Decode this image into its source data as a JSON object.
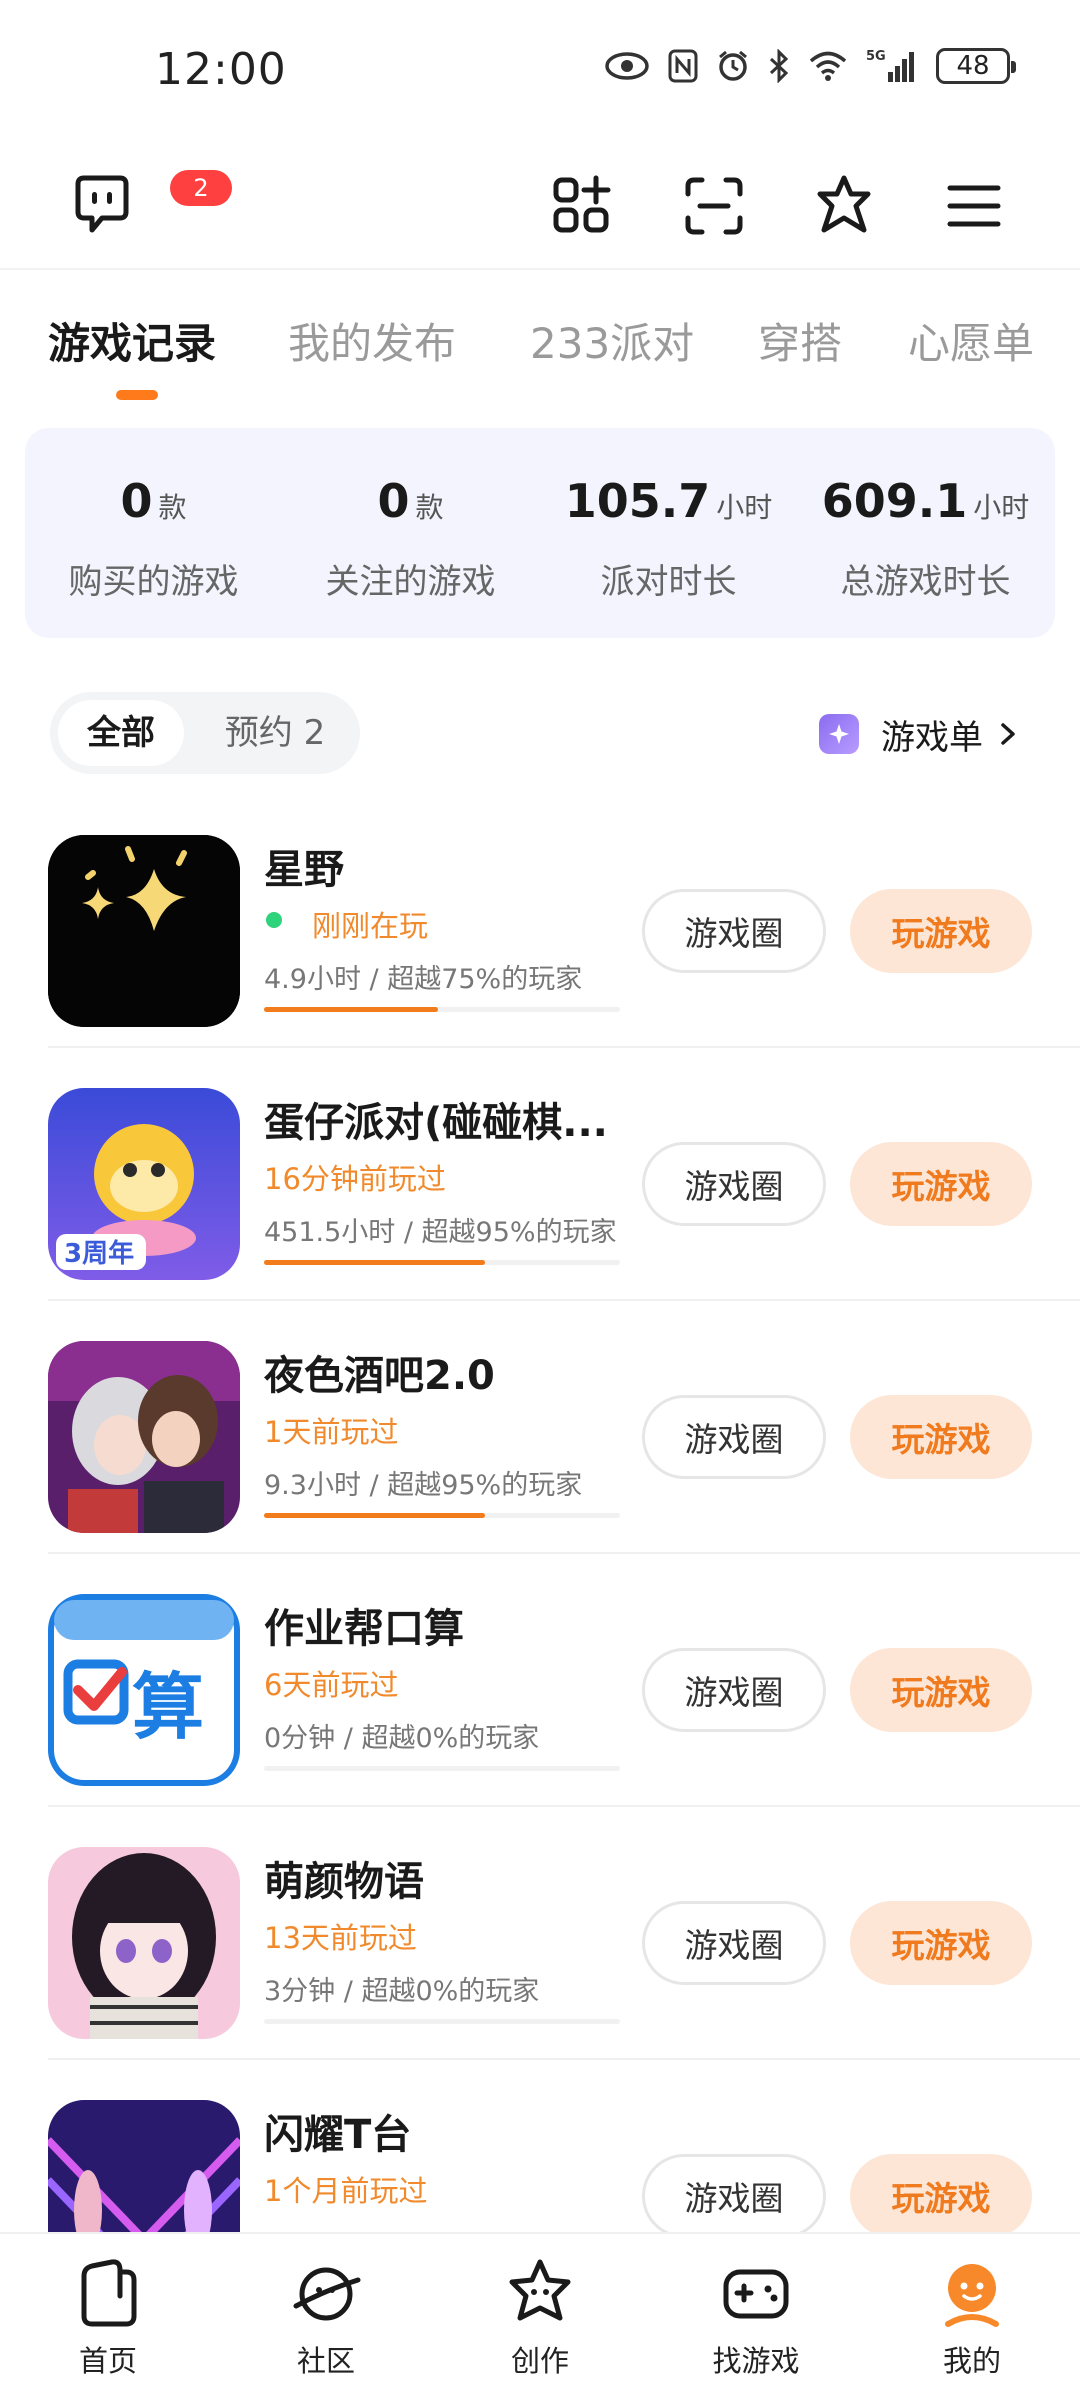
{
  "status_bar": {
    "time": "12:00",
    "network": "5G",
    "battery": "48"
  },
  "toolbar": {
    "message_badge": "2"
  },
  "tabs": [
    {
      "label": "游戏记录",
      "active": true
    },
    {
      "label": "我的发布",
      "active": false
    },
    {
      "label": "233派对",
      "active": false
    },
    {
      "label": "穿搭",
      "active": false
    },
    {
      "label": "心愿单",
      "active": false
    }
  ],
  "stats": [
    {
      "value": "0",
      "unit": "款",
      "label": "购买的游戏"
    },
    {
      "value": "0",
      "unit": "款",
      "label": "关注的游戏"
    },
    {
      "value": "105.7",
      "unit": "小时",
      "label": "派对时长"
    },
    {
      "value": "609.1",
      "unit": "小时",
      "label": "总游戏时长"
    }
  ],
  "filter": {
    "all": "全部",
    "reserve": "预约 2",
    "game_list": "游戏单"
  },
  "games": [
    {
      "name": "星野",
      "last_played": "刚刚在玩",
      "playing_now": true,
      "stats": "4.9小时 / 超越75%的玩家",
      "progress": 0.49,
      "icon": "xingye-icon"
    },
    {
      "name": "蛋仔派对(碰碰棋...",
      "last_played": "16分钟前玩过",
      "playing_now": false,
      "stats": "451.5小时 / 超越95%的玩家",
      "progress": 0.62,
      "icon": "eggy-party-icon"
    },
    {
      "name": "夜色酒吧2.0",
      "last_played": "1天前玩过",
      "playing_now": false,
      "stats": "9.3小时 / 超越95%的玩家",
      "progress": 0.62,
      "icon": "night-bar-icon"
    },
    {
      "name": "作业帮口算",
      "last_played": "6天前玩过",
      "playing_now": false,
      "stats": "0分钟 / 超越0%的玩家",
      "progress": 0,
      "icon": "zuoyebang-icon"
    },
    {
      "name": "萌颜物语",
      "last_played": "13天前玩过",
      "playing_now": false,
      "stats": "3分钟 / 超越0%的玩家",
      "progress": 0,
      "icon": "mengyan-icon"
    },
    {
      "name": "闪耀T台",
      "last_played": "1个月前玩过",
      "playing_now": false,
      "stats": "",
      "progress": 0,
      "icon": "shining-runway-icon"
    }
  ],
  "buttons": {
    "circle": "游戏圈",
    "play": "玩游戏"
  },
  "bottom_nav": [
    {
      "label": "首页",
      "icon": "home-icon"
    },
    {
      "label": "社区",
      "icon": "community-planet-icon"
    },
    {
      "label": "创作",
      "icon": "create-star-icon"
    },
    {
      "label": "找游戏",
      "icon": "gamepad-icon"
    },
    {
      "label": "我的",
      "icon": "profile-icon",
      "active": true
    }
  ],
  "colors": {
    "accent": "#f27b1c",
    "play_bg": "#fde6d6",
    "live": "#2fd37b",
    "badge": "#ff4040",
    "card_bg": "#f3f4fd"
  }
}
